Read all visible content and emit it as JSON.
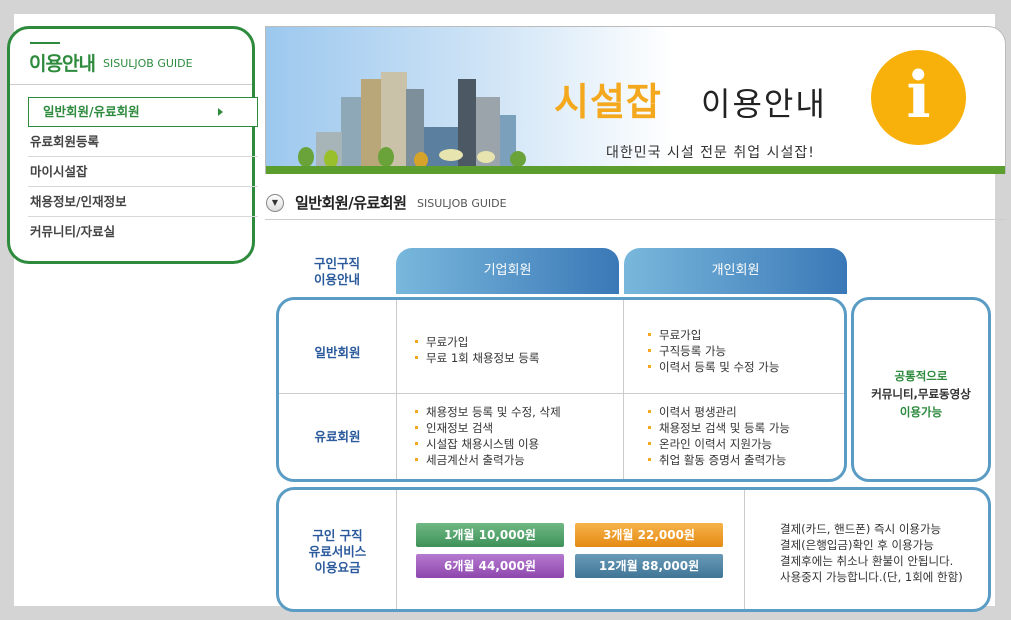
{
  "sidebar": {
    "title": "이용안내",
    "subtitle": "SISULJOB GUIDE",
    "items": [
      {
        "label": "일반회원/유료회원"
      },
      {
        "label": "유료회원등록"
      },
      {
        "label": "마이시설잡"
      },
      {
        "label": "채용정보/인재정보"
      },
      {
        "label": "커뮤니티/자료실"
      }
    ]
  },
  "banner": {
    "title_highlight": "시설잡",
    "title_rest": "이용안내",
    "subtitle": "대한민국 시설 전문 취업 시설잡!",
    "info_symbol": "i"
  },
  "section": {
    "title": "일반회원/유료회원",
    "subtitle": "SISULJOB GUIDE"
  },
  "guide_table": {
    "header_label_line1": "구인구직",
    "header_label_line2": "이용안내",
    "tabs": [
      "기업회원",
      "개인회원"
    ],
    "rows": [
      {
        "label": "일반회원",
        "corporate": [
          "무료가입",
          "무료 1회 채용정보 등록"
        ],
        "individual": [
          "무료가입",
          "구직등록 가능",
          "이력서 등록 및 수정 가능"
        ]
      },
      {
        "label": "유료회원",
        "corporate": [
          "채용정보 등록 및 수정, 삭제",
          "인재정보 검색",
          "시설잡 채용시스템 이용",
          "세금계산서 출력가능"
        ],
        "individual": [
          "이력서 평생관리",
          "채용정보 검색 및 등록 가능",
          "온라인 이력서 지원가능",
          "취업 활동 증명서 출력가능"
        ]
      }
    ],
    "common": {
      "line1": "공통적으로",
      "line2": "커뮤니티,무료동영상",
      "line3": "이용가능"
    }
  },
  "pricing": {
    "label_line1": "구인 구직",
    "label_line2": "유료서비스",
    "label_line3": "이용요금",
    "plans": [
      {
        "label": "1개월  10,000원",
        "color": "#3e9159"
      },
      {
        "label": "3개월  22,000원",
        "color": "#e58a13"
      },
      {
        "label": "6개월  44,000원",
        "color": "#8e47ad"
      },
      {
        "label": "12개월  88,000원",
        "color": "#3f7596"
      }
    ],
    "notes": [
      "결제(카드, 핸드폰) 즉시 이용가능",
      "결제(은행입금)확인 후 이용가능",
      "결제후에는 취소나 환불이 안됩니다.",
      "사용중지 가능합니다.(단, 1회에 한함)"
    ]
  }
}
